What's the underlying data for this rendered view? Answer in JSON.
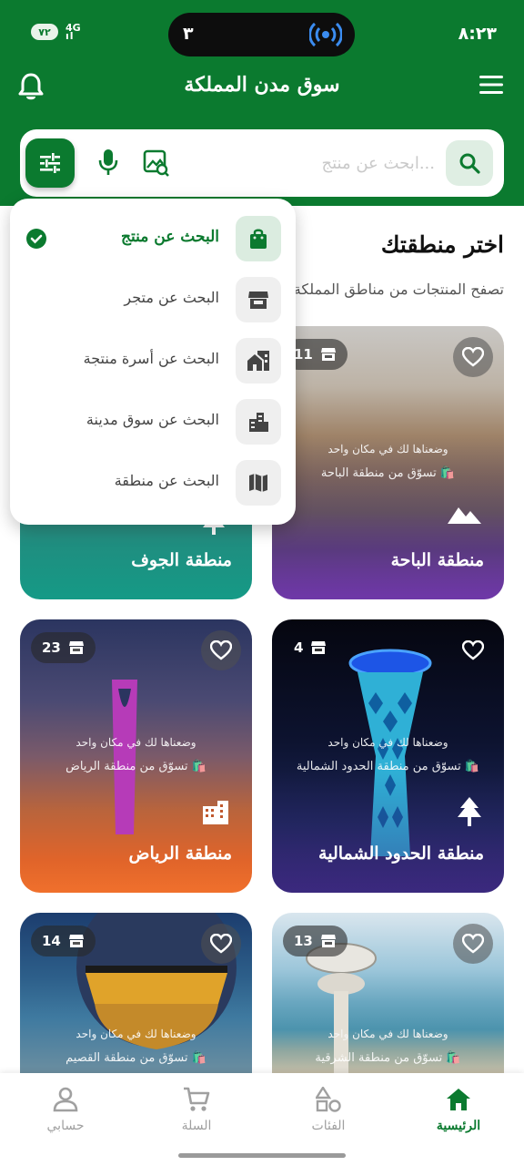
{
  "status_bar": {
    "time": "٨:٢٣",
    "battery": "٧٢",
    "network": "4G",
    "island_number": "٣"
  },
  "header": {
    "title": "سوق مدن المملكة"
  },
  "search": {
    "placeholder": "ابحث عن منتج..."
  },
  "section": {
    "title": "اختر منطقتك",
    "subtitle": "تصفح المنتجات من مناطق المملكة ا"
  },
  "cards": [
    {
      "name": "منطقة الباحة",
      "count": "11",
      "tagline": "وضعناها لك في مكان واحد",
      "shop_text": "تسوّق من منطقة الباحة 🛍️",
      "icon": "mountain-icon"
    },
    {
      "name": "منطقة الجوف",
      "count": "",
      "tagline": "",
      "shop_text": "",
      "icon": "tree-icon"
    },
    {
      "name": "منطقة الحدود الشمالية",
      "count": "4",
      "tagline": "وضعناها لك في مكان واحد",
      "shop_text": "تسوّق من منطقة الحدود الشمالية 🛍️",
      "icon": "tree-icon"
    },
    {
      "name": "منطقة الرياض",
      "count": "23",
      "tagline": "وضعناها لك في مكان واحد",
      "shop_text": "تسوّق من منطقة الرياض 🛍️",
      "icon": "buildings-icon"
    },
    {
      "name": "",
      "count": "13",
      "tagline": "وضعناها لك في مكان واحد",
      "shop_text": "تسوّق من منطقة الشرقية 🛍️",
      "icon": ""
    },
    {
      "name": "",
      "count": "14",
      "tagline": "وضعناها لك في مكان واحد",
      "shop_text": "تسوّق من منطقة القصيم 🛍️",
      "icon": ""
    }
  ],
  "search_menu": {
    "options": [
      {
        "label": "البحث عن منتج",
        "icon": "shopping-bag-icon",
        "selected": true
      },
      {
        "label": "البحث عن متجر",
        "icon": "store-icon",
        "selected": false
      },
      {
        "label": "البحث عن أسرة منتجة",
        "icon": "home-work-icon",
        "selected": false
      },
      {
        "label": "البحث عن سوق مدينة",
        "icon": "city-icon",
        "selected": false
      },
      {
        "label": "البحث عن منطقة",
        "icon": "map-icon",
        "selected": false
      }
    ]
  },
  "bottom_nav": [
    {
      "label": "الرئيسية",
      "icon": "home-icon",
      "active": true
    },
    {
      "label": "الفئات",
      "icon": "categories-icon",
      "active": false
    },
    {
      "label": "السلة",
      "icon": "cart-icon",
      "active": false
    },
    {
      "label": "حسابي",
      "icon": "person-icon",
      "active": false
    }
  ],
  "colors": {
    "primary": "#0b7a2f",
    "accent_light": "#dfeee3"
  }
}
